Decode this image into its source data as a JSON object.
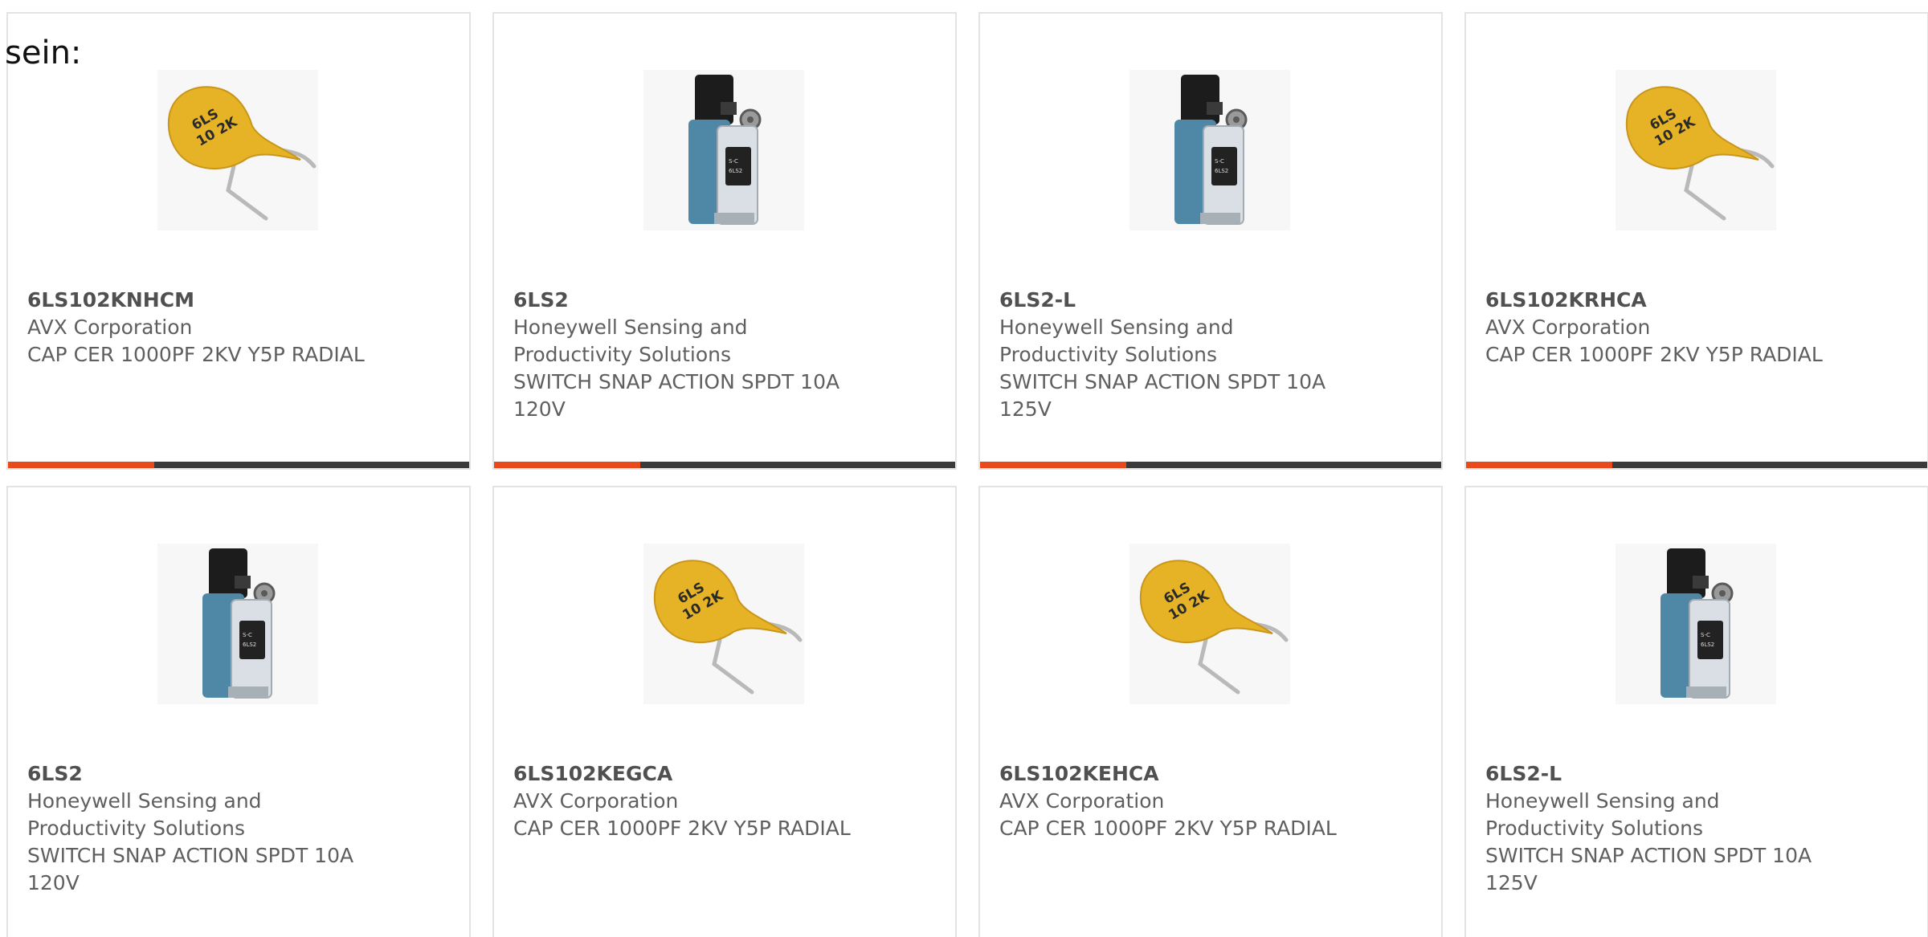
{
  "intro_text": "sein:",
  "colors": {
    "accent": "#e84a1b",
    "bar": "#3b3b3b",
    "card_border": "#e3e3e3"
  },
  "products": [
    {
      "part_number": "6LS102KNHCM",
      "manufacturer": "AVX Corporation",
      "description": "CAP CER 1000PF 2KV Y5P RADIAL",
      "image": "ceramic-capacitor-image"
    },
    {
      "part_number": "6LS2",
      "manufacturer": "Honeywell Sensing and Productivity Solutions",
      "description": "SWITCH SNAP ACTION SPDT 10A 120V",
      "image": "limit-switch-image"
    },
    {
      "part_number": "6LS2-L",
      "manufacturer": "Honeywell Sensing and Productivity Solutions",
      "description": "SWITCH SNAP ACTION SPDT 10A 125V",
      "image": "limit-switch-image"
    },
    {
      "part_number": "6LS102KRHCA",
      "manufacturer": "AVX Corporation",
      "description": "CAP CER 1000PF 2KV Y5P RADIAL",
      "image": "ceramic-capacitor-image"
    },
    {
      "part_number": "6LS2",
      "manufacturer": "Honeywell Sensing and Productivity Solutions",
      "description": "SWITCH SNAP ACTION SPDT 10A 120V",
      "image": "limit-switch-image"
    },
    {
      "part_number": "6LS102KEGCA",
      "manufacturer": "AVX Corporation",
      "description": "CAP CER 1000PF 2KV Y5P RADIAL",
      "image": "ceramic-capacitor-image"
    },
    {
      "part_number": "6LS102KEHCA",
      "manufacturer": "AVX Corporation",
      "description": "CAP CER 1000PF 2KV Y5P RADIAL",
      "image": "ceramic-capacitor-image"
    },
    {
      "part_number": "6LS2-L",
      "manufacturer": "Honeywell Sensing and Productivity Solutions",
      "description": "SWITCH SNAP ACTION SPDT 10A 125V",
      "image": "limit-switch-image"
    }
  ]
}
